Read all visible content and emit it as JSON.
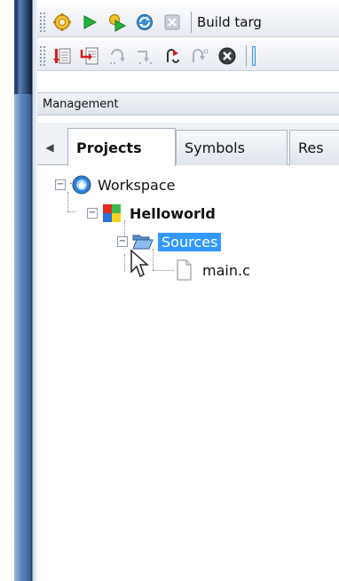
{
  "toolbar1": {
    "build_target_label": "Build targ",
    "buttons": [
      "build-icon",
      "run-icon",
      "build-run-icon",
      "rebuild-icon",
      "abort-icon"
    ]
  },
  "toolbar2": {
    "buttons": [
      "debug-run-icon",
      "run-to-cursor-icon",
      "next-line-icon",
      "step-into-icon",
      "step-out-icon",
      "next-instruction-icon",
      "stop-debugger-icon"
    ]
  },
  "management": {
    "title": "Management",
    "tabs": [
      {
        "label": "Projects",
        "active": true
      },
      {
        "label": "Symbols",
        "active": false
      },
      {
        "label": "Res",
        "active": false
      }
    ]
  },
  "tree": {
    "workspace": "Workspace",
    "project": "Helloworld",
    "folder": "Sources",
    "file": "main.c"
  },
  "colors": {
    "selection": "#3399ff",
    "toolbar_bg": "#eef1f5"
  }
}
